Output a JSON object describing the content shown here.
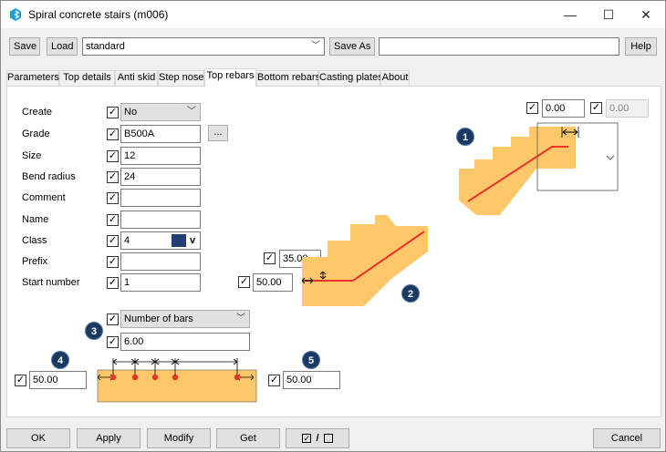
{
  "window": {
    "title": "Spiral concrete stairs (m006)",
    "minimize_symbol": "—",
    "maximize_symbol": "☐",
    "close_symbol": "✕"
  },
  "toolbar": {
    "save_label": "Save",
    "load_label": "Load",
    "preset_value": "standard",
    "save_as_label": "Save As",
    "save_as_value": "",
    "help_label": "Help"
  },
  "tabs": [
    {
      "label": "Parameters"
    },
    {
      "label": "Top details"
    },
    {
      "label": "Anti skid"
    },
    {
      "label": "Step nose"
    },
    {
      "label": "Top rebars"
    },
    {
      "label": "Bottom rebars"
    },
    {
      "label": "Casting plates"
    },
    {
      "label": "About"
    }
  ],
  "form": {
    "create": {
      "label": "Create",
      "value": "No"
    },
    "grade": {
      "label": "Grade",
      "value": "B500A",
      "browse_label": "..."
    },
    "size": {
      "label": "Size",
      "value": "12"
    },
    "bend_radius": {
      "label": "Bend radius",
      "value": "24"
    },
    "comment": {
      "label": "Comment",
      "value": ""
    },
    "name": {
      "label": "Name",
      "value": ""
    },
    "class": {
      "label": "Class",
      "value": "4",
      "color": "#1f3c73",
      "dropdown_symbol": "v"
    },
    "prefix": {
      "label": "Prefix",
      "value": ""
    },
    "start_number": {
      "label": "Start number",
      "value": "1"
    }
  },
  "check_symbol": "✓",
  "top_right": {
    "value1": "0.00",
    "value2": "0.00"
  },
  "diagram2": {
    "cover_top": "35.00",
    "cover_left": "50.00"
  },
  "spacing": {
    "mode": "Number of bars",
    "value": "6.00"
  },
  "left_cover": {
    "value": "50.00"
  },
  "right_cover": {
    "value": "50.00"
  },
  "badges": [
    "1",
    "2",
    "3",
    "4",
    "5"
  ],
  "colors": {
    "concrete": "#fdc76a",
    "rebar": "#e8342a",
    "badge": "#1b3a63",
    "logo": "#1aa0d8"
  },
  "bottom": {
    "ok_label": "OK",
    "apply_label": "Apply",
    "modify_label": "Modify",
    "get_label": "Get",
    "toggle_separator": "/",
    "cancel_label": "Cancel"
  }
}
